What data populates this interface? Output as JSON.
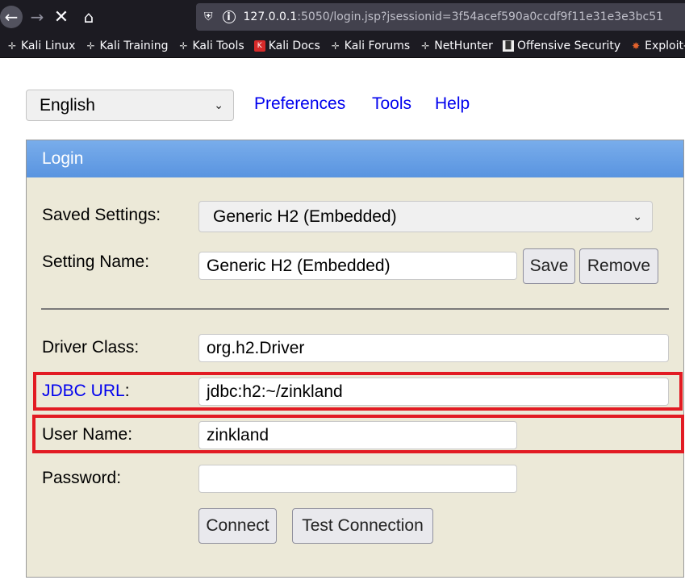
{
  "browser": {
    "url_host": "127.0.0.1",
    "url_rest": ":5050/login.jsp?jsessionid=3f54acef590a0ccdf9f11e31e3e3bc51",
    "bookmarks": [
      {
        "label": "Kali Linux",
        "icon": "kali-dragon-icon"
      },
      {
        "label": "Kali Training",
        "icon": "kali-dragon-icon"
      },
      {
        "label": "Kali Tools",
        "icon": "kali-dragon-icon"
      },
      {
        "label": "Kali Docs",
        "icon": "docs-icon"
      },
      {
        "label": "Kali Forums",
        "icon": "kali-dragon-icon"
      },
      {
        "label": "NetHunter",
        "icon": "kali-dragon-icon"
      },
      {
        "label": "Offensive Security",
        "icon": "offsec-icon"
      },
      {
        "label": "Exploit-D",
        "icon": "exploit-db-icon"
      }
    ]
  },
  "top": {
    "language": "English",
    "links": [
      "Preferences",
      "Tools",
      "Help"
    ]
  },
  "login": {
    "header": "Login",
    "saved_settings_label": "Saved Settings:",
    "saved_settings_value": "Generic H2 (Embedded)",
    "setting_name_label": "Setting Name:",
    "setting_name_value": "Generic H2 (Embedded)",
    "save_label": "Save",
    "remove_label": "Remove",
    "driver_class_label": "Driver Class:",
    "driver_class_value": "org.h2.Driver",
    "jdbc_url_link": "JDBC URL",
    "jdbc_url_colon": ":",
    "jdbc_url_value": "jdbc:h2:~/zinkland",
    "user_name_label": "User Name:",
    "user_name_value": "zinkland",
    "password_label": "Password:",
    "password_value": "",
    "connect_label": "Connect",
    "test_connection_label": "Test Connection"
  },
  "colors": {
    "highlight": "#e21b23",
    "panel_bg": "#ece9d8",
    "header_blue": "#5994e0",
    "link": "#0000ee"
  }
}
